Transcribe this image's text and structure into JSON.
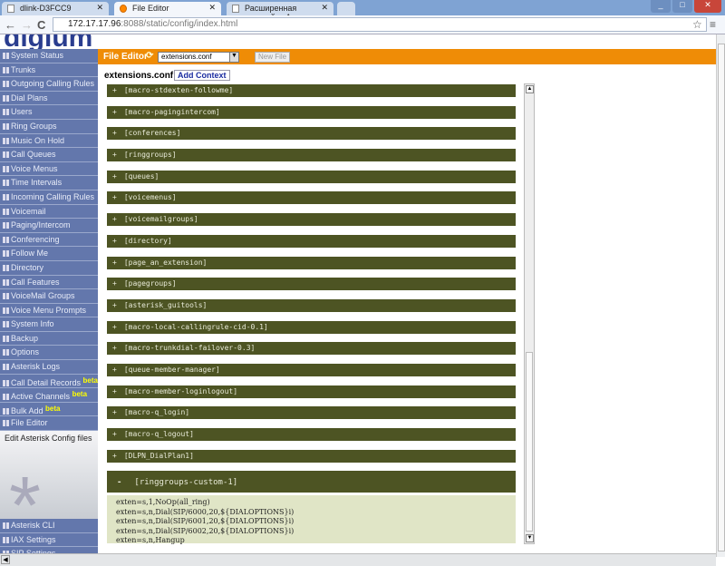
{
  "browser": {
    "tabs": [
      {
        "label": "dlink-D3FCC9"
      },
      {
        "label": "File Editor"
      },
      {
        "label": "Расширенная настройка А"
      }
    ],
    "url_host": "172.17.17.96",
    "url_rest": ":8088/static/config/index.html"
  },
  "logo": "digium",
  "sidebar": {
    "items": [
      "System Status",
      "Trunks",
      "Outgoing Calling Rules",
      "Dial Plans",
      "Users",
      "Ring Groups",
      "Music On Hold",
      "Call Queues",
      "Voice Menus",
      "Time Intervals",
      "Incoming Calling Rules",
      "Voicemail",
      "Paging/Intercom",
      "Conferencing",
      "Follow Me",
      "Directory",
      "Call Features",
      "VoiceMail Groups",
      "Voice Menu Prompts",
      "System Info",
      "Backup",
      "Options",
      "Asterisk Logs",
      "Call Detail Records",
      "Active Channels",
      "Bulk Add",
      "File Editor"
    ],
    "beta_label": "beta",
    "description": "Edit Asterisk Config files",
    "bottom_items": [
      "Asterisk CLI",
      "IAX Settings",
      "SIP Settings"
    ]
  },
  "header": {
    "title": "File Editor",
    "file_select": "extensions.conf",
    "new_file": "New File"
  },
  "file": {
    "name": "extensions.conf",
    "add_context": "Add Context"
  },
  "contexts": [
    "[macro-stdexten-followme]",
    "[macro-pagingintercom]",
    "[conferences]",
    "[ringgroups]",
    "[queues]",
    "[voicemenus]",
    "[voicemailgroups]",
    "[directory]",
    "[page_an_extension]",
    "[pagegroups]",
    "[asterisk_guitools]",
    "[macro-local-callingrule-cid-0.1]",
    "[macro-trunkdial-failover-0.3]",
    "[queue-member-manager]",
    "[macro-member-loginlogout]",
    "[macro-q_login]",
    "[macro-q_logout]",
    "[DLPN_DialPlan1]"
  ],
  "expanded": {
    "name": "[ringgroups-custom-1]",
    "lines": [
      "exten=s,1,NoOp(all_ring)",
      "exten=s,n,Dial(SIP/6000,20,${DIALOPTIONS}i)",
      "exten=s,n,Dial(SIP/6001,20,${DIALOPTIONS}i)",
      "exten=s,n,Dial(SIP/6002,20,${DIALOPTIONS}i)",
      "exten=s,n,Hangup"
    ]
  },
  "colors": {
    "header": "#ef8c06",
    "sidebar": "#6377ac",
    "context_row": "#4d5423",
    "code_bg": "#e0e5c6"
  }
}
